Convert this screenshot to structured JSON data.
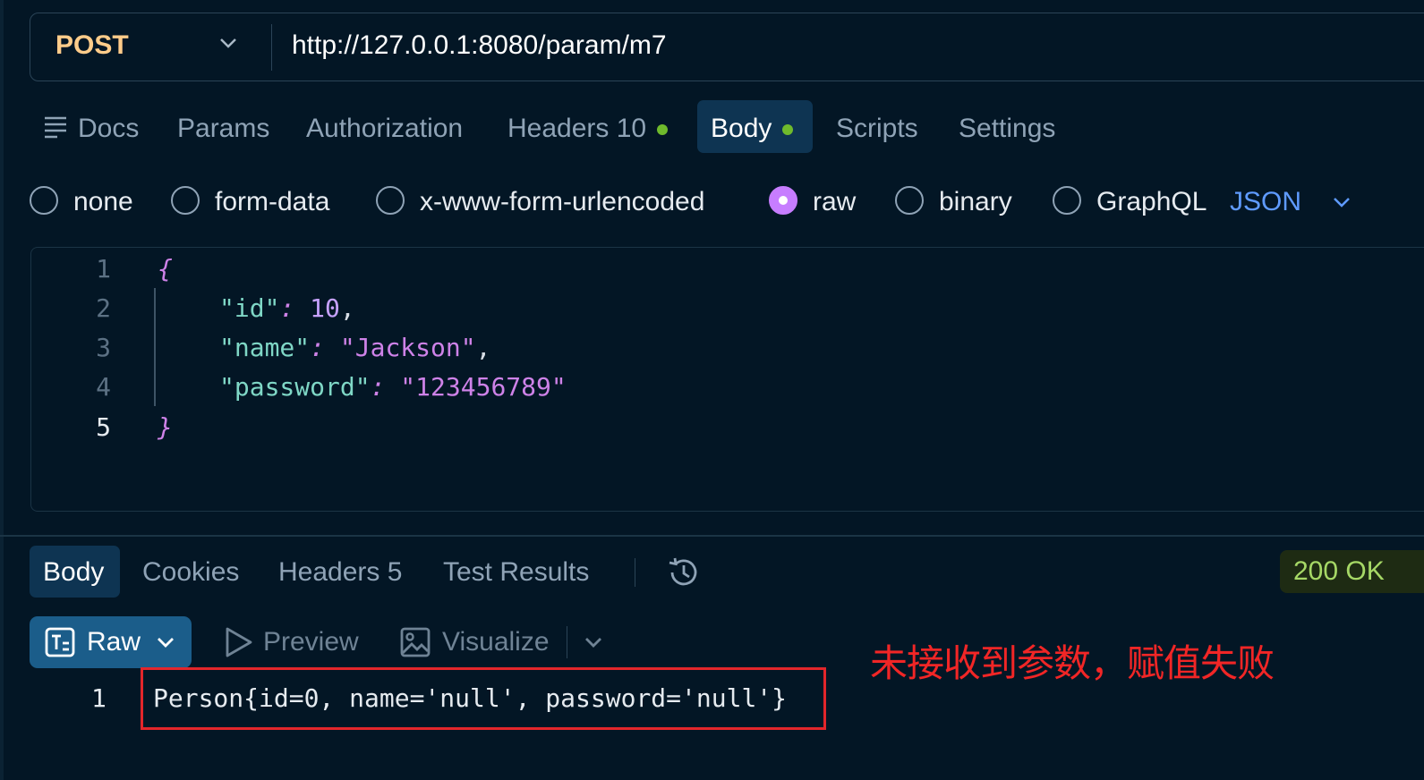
{
  "request": {
    "method": "POST",
    "url": "http://127.0.0.1:8080/param/m7",
    "tabs": {
      "docs": "Docs",
      "params": "Params",
      "authorization": "Authorization",
      "headers": "Headers 10",
      "body": "Body",
      "scripts": "Scripts",
      "settings": "Settings"
    },
    "body_types": {
      "none": "none",
      "form_data": "form-data",
      "urlencoded": "x-www-form-urlencoded",
      "raw": "raw",
      "binary": "binary",
      "graphql": "GraphQL",
      "selected": "raw"
    },
    "format": "JSON",
    "editor": {
      "line_numbers": [
        "1",
        "2",
        "3",
        "4",
        "5"
      ],
      "open_brace": "{",
      "close_brace": "}",
      "id_key": "\"id\"",
      "id_value": "10",
      "name_key": "\"name\"",
      "name_value": "\"Jackson\"",
      "password_key": "\"password\"",
      "password_value": "\"123456789\""
    }
  },
  "response": {
    "tabs": {
      "body": "Body",
      "cookies": "Cookies",
      "headers": "Headers 5",
      "test_results": "Test Results"
    },
    "status": "200 OK",
    "view": {
      "raw": "Raw",
      "preview": "Preview",
      "visualize": "Visualize"
    },
    "line_number": "1",
    "content": "Person{id=0, name='null', password='null'}",
    "annotation": "未接收到参数，赋值失败"
  },
  "colors": {
    "background": "#031625",
    "method": "#ffcc8a",
    "active_tab": "#0e3452",
    "dot": "#6fba2c",
    "radio_checked": "#c77dff",
    "json_accent": "#5f9bff",
    "status_text": "#a6d866",
    "annotation": "#f12626"
  }
}
